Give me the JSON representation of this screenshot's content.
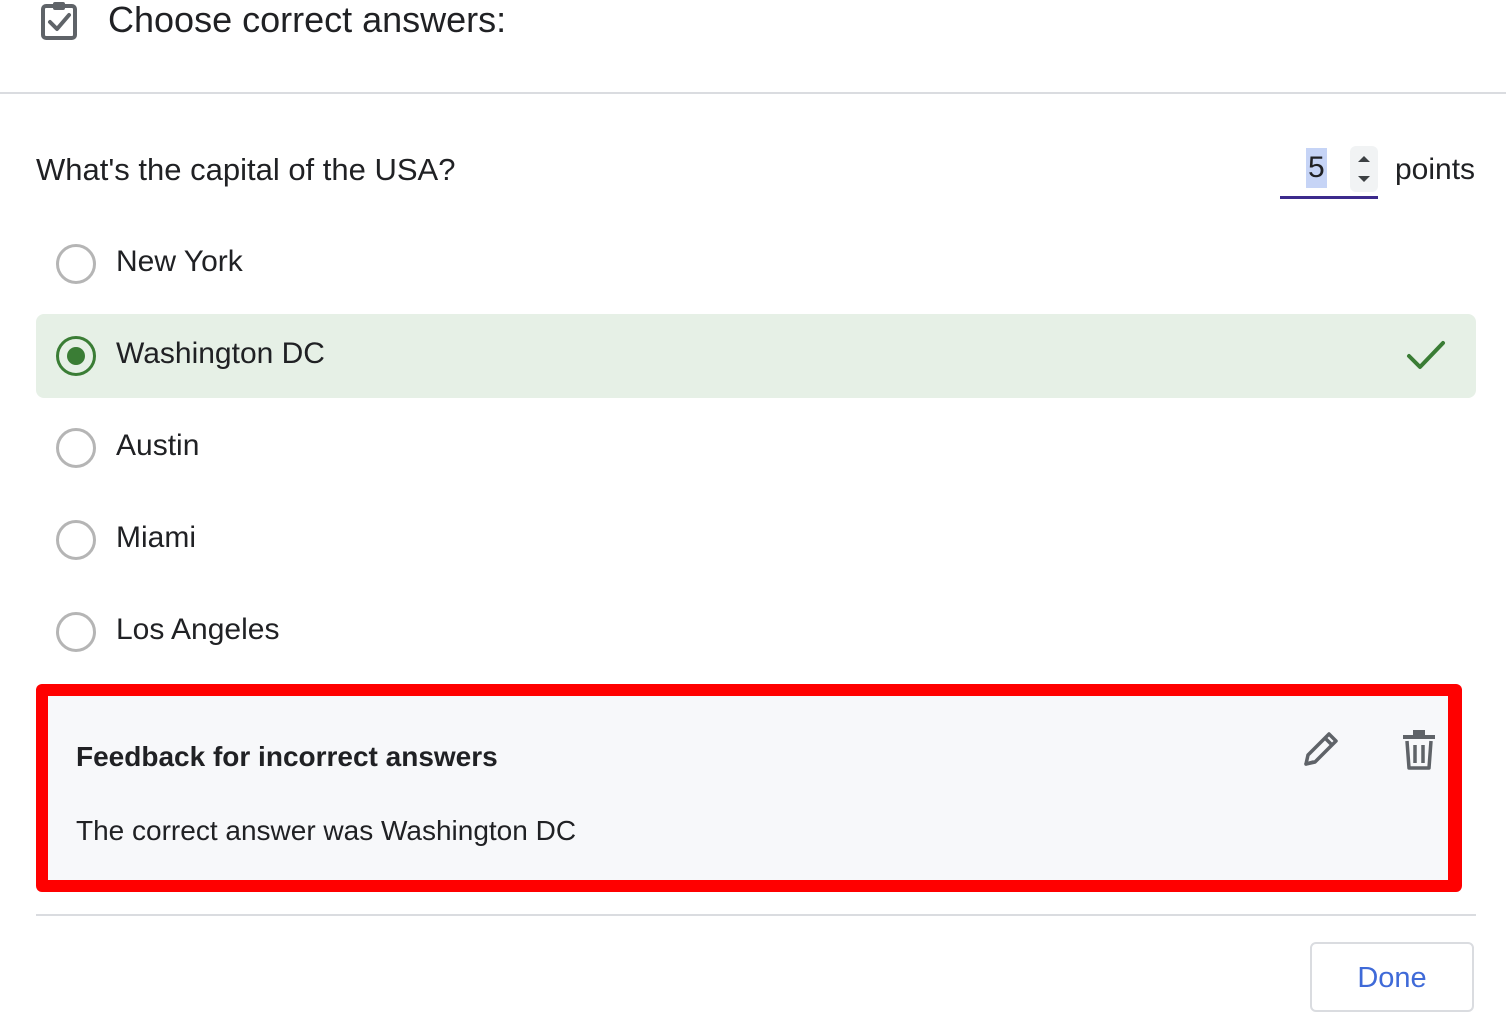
{
  "header": {
    "title": "Choose correct answers:",
    "icon": "checkbox-clipboard-icon"
  },
  "question": {
    "text": "What's the capital of the USA?",
    "points_value": "5",
    "points_label": "points"
  },
  "options": [
    {
      "label": "New York",
      "selected": false,
      "correct": false
    },
    {
      "label": "Washington DC",
      "selected": true,
      "correct": true
    },
    {
      "label": "Austin",
      "selected": false,
      "correct": false
    },
    {
      "label": "Miami",
      "selected": false,
      "correct": false
    },
    {
      "label": "Los Angeles",
      "selected": false,
      "correct": false
    }
  ],
  "feedback": {
    "title": "Feedback for incorrect answers",
    "text": "The correct answer was Washington DC",
    "edit_icon": "pencil-icon",
    "delete_icon": "trash-icon"
  },
  "actions": {
    "done_label": "Done"
  },
  "colors": {
    "correct_green": "#3a7d35",
    "correct_background": "#e6f0e6",
    "highlight_red": "#ff0000",
    "accent_blue": "#3f6ad8"
  }
}
